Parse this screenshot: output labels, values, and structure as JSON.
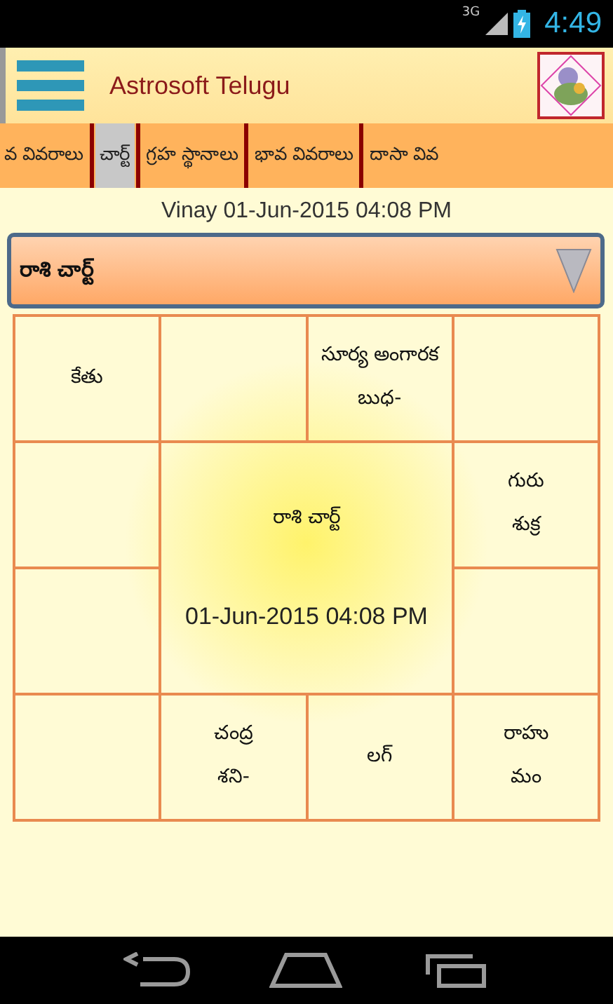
{
  "status_bar": {
    "network": "3G",
    "time": "4:49"
  },
  "app_bar": {
    "title": "Astrosoft Telugu"
  },
  "tabs": [
    {
      "label": "వ వివరాలు",
      "selected": false
    },
    {
      "label": "చార్ట్",
      "selected": true
    },
    {
      "label": "గ్రహ స్థానాలు",
      "selected": false
    },
    {
      "label": "భావ వివరాలు",
      "selected": false
    },
    {
      "label": "దాసా వివ",
      "selected": false
    }
  ],
  "subtitle": "Vinay 01-Jun-2015 04:08 PM",
  "chart_select": {
    "value": "రాశి చార్ట్"
  },
  "chart": {
    "center": {
      "title": "రాశి చార్ట్",
      "date": "01-Jun-2015 04:08 PM"
    },
    "cells": [
      {
        "lines": [
          "కేతు"
        ]
      },
      {},
      {
        "lines": [
          "సూర్య అంగారక",
          "బుధ-"
        ]
      },
      {},
      {},
      {
        "lines": [
          "గురు",
          "శుక్ర"
        ]
      },
      {},
      {},
      {},
      {
        "lines": [
          "చంద్ర",
          "శని-"
        ]
      },
      {
        "lines": [
          "లగ్"
        ]
      },
      {
        "lines": [
          "రాహు",
          "మం"
        ]
      }
    ]
  }
}
